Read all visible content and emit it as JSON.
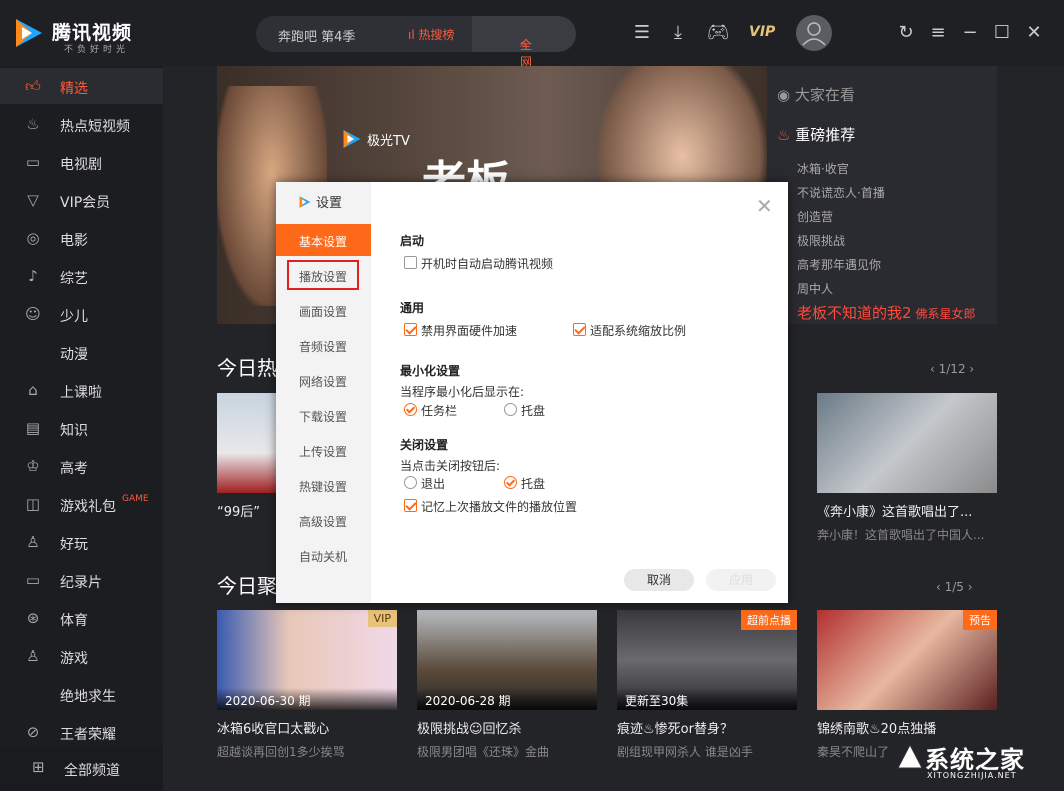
{
  "app": {
    "name": "腾讯视频",
    "slogan": "不负好时光"
  },
  "search": {
    "query": "奔跑吧 第4季",
    "hot_label": "热搜榜",
    "all_label": "全网搜"
  },
  "toolbar": {
    "vip_label": "VIP"
  },
  "sidebar": {
    "items": [
      {
        "label": "精选",
        "icon": "thumbs-up-icon",
        "active": true
      },
      {
        "label": "热点短视频",
        "icon": "flame-icon"
      },
      {
        "label": "电视剧",
        "icon": "tv-icon"
      },
      {
        "label": "VIP会员",
        "icon": "vip-icon"
      },
      {
        "label": "电影",
        "icon": "film-reel-icon"
      },
      {
        "label": "综艺",
        "icon": "microphone-icon"
      },
      {
        "label": "少儿",
        "icon": "kid-icon"
      },
      {
        "label": "动漫",
        "icon": ""
      },
      {
        "label": "上课啦",
        "icon": "graduation-cap-icon"
      },
      {
        "label": "知识",
        "icon": "book-icon"
      },
      {
        "label": "高考",
        "icon": "exam-icon"
      },
      {
        "label": "游戏礼包",
        "icon": "gamepad-icon",
        "tag": "GAME"
      },
      {
        "label": "好玩",
        "icon": "joystick-icon"
      },
      {
        "label": "纪录片",
        "icon": "camera-icon"
      },
      {
        "label": "体育",
        "icon": "basketball-icon"
      },
      {
        "label": "游戏",
        "icon": "joystick-icon"
      },
      {
        "label": "绝地求生",
        "icon": ""
      },
      {
        "label": "王者荣耀",
        "icon": "compass-icon"
      }
    ],
    "all_channels": "全部频道"
  },
  "recommend": {
    "watching": "大家在看",
    "heavy": "重磅推荐",
    "items": [
      "冰箱·收官",
      "不说谎恋人·首播",
      "创造营",
      "极限挑战",
      "高考那年遇见你",
      "周中人"
    ],
    "feature": "老板不知道的我2",
    "feature_sub": "佛系星女郎"
  },
  "banner": {
    "brand": "极光TV",
    "title_char": "老板"
  },
  "sections": [
    {
      "title": "今日热",
      "pager": "1/12"
    },
    {
      "title": "今日聚",
      "pager": "1/5"
    }
  ],
  "hot_cards": [
    {
      "title": "“99后”",
      "sub": ""
    },
    {
      "title": "《奔小康》这首歌唱出了...",
      "sub": "奔小康！这首歌唱出了中国人..."
    }
  ],
  "focus_cards": [
    {
      "date": "2020-06-30 期",
      "tag": "VIP",
      "title": "冰箱6收官口太戳心",
      "sub": "超越谈再回创1多少挨骂"
    },
    {
      "date": "2020-06-28 期",
      "tag": "",
      "title": "极限挑战☺回忆杀",
      "sub": "极限男团唱《还珠》金曲"
    },
    {
      "date": "更新至30集",
      "tag": "超前点播",
      "title": "痕迹♨惨死or替身？",
      "sub": "剧组现甲网杀人 谁是凶手"
    },
    {
      "date": "",
      "tag": "预告",
      "title": "锦绣南歌♨20点独播",
      "sub": "秦昊不爬山了"
    }
  ],
  "dialog": {
    "title": "设置",
    "nav": [
      "基本设置",
      "播放设置",
      "画面设置",
      "音频设置",
      "网络设置",
      "下载设置",
      "上传设置",
      "热键设置",
      "高级设置",
      "自动关机"
    ],
    "startup": {
      "heading": "启动",
      "autostart": "开机时自动启动腾讯视频",
      "autostart_checked": false
    },
    "general": {
      "heading": "通用",
      "disable_hw": "禁用界面硬件加速",
      "disable_hw_checked": true,
      "adapt_scale": "适配系统缩放比例",
      "adapt_scale_checked": true
    },
    "minimize": {
      "heading": "最小化设置",
      "desc": "当程序最小化后显示在:",
      "opt_taskbar": "任务栏",
      "opt_tray": "托盘",
      "selected": "任务栏"
    },
    "close": {
      "heading": "关闭设置",
      "desc": "当点击关闭按钮后:",
      "opt_exit": "退出",
      "opt_tray": "托盘",
      "selected": "托盘",
      "remember": "记忆上次播放文件的播放位置",
      "remember_checked": true
    },
    "cancel": "取消",
    "apply": "应用"
  },
  "watermark": {
    "brand": "系统之家",
    "domain": "XITONGZHIJIA.NET"
  },
  "colors": {
    "accent": "#ff6a1a",
    "hot": "#ff5a3c",
    "sidebar_bg": "#1c1d21"
  }
}
